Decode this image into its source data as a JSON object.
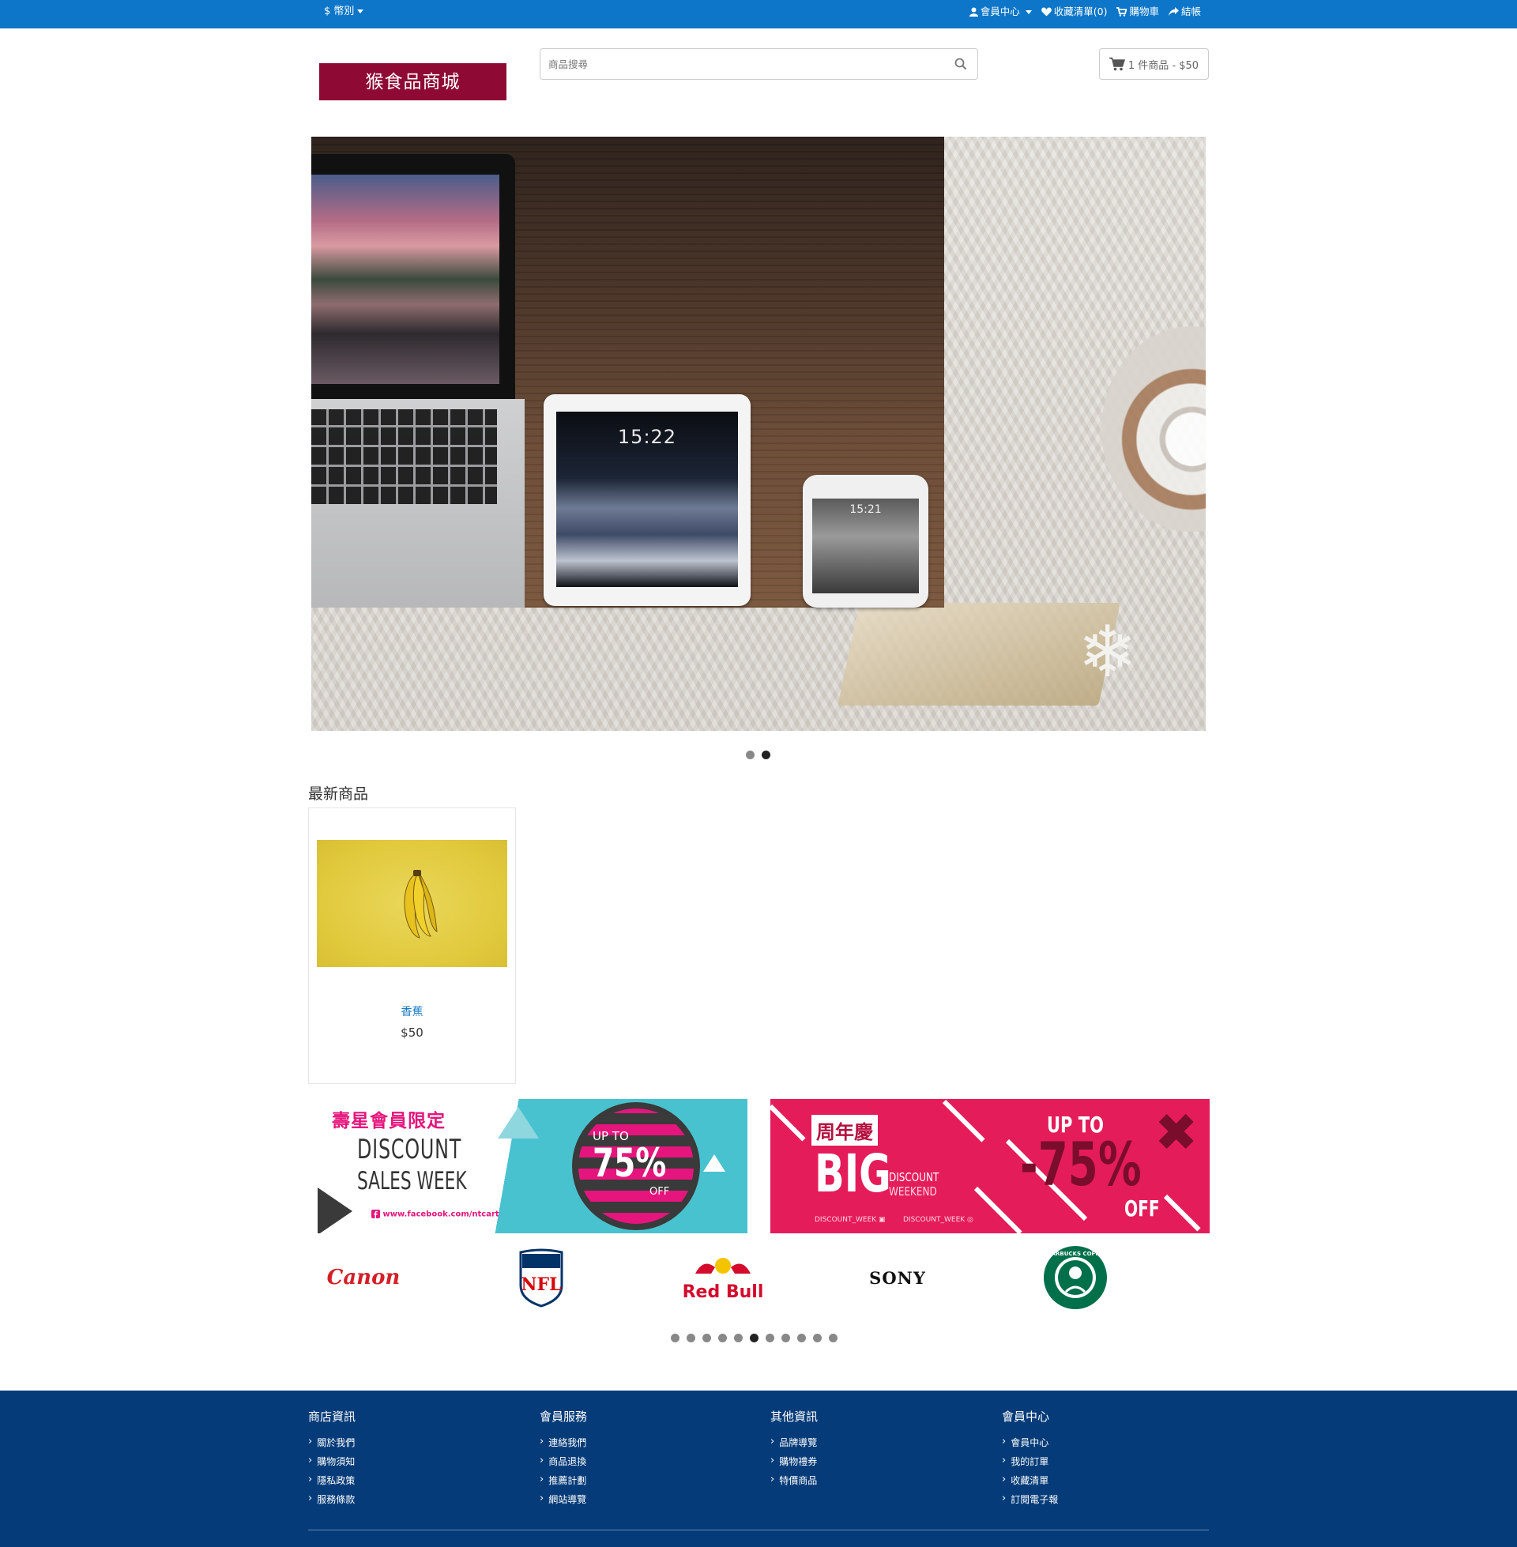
{
  "topbar": {
    "currency": "$ 幣別",
    "links": {
      "member_center": "會員中心",
      "wishlist": "收藏清單(0)",
      "cart": "購物車",
      "checkout": "結帳"
    }
  },
  "header": {
    "logo_text": "猴食品商城",
    "search_placeholder": "商品搜尋",
    "cart_summary": "1 件商品 - $50"
  },
  "hero": {
    "tablet_time": "15:22",
    "phone_time": "15:21",
    "slide_count": 2,
    "active_slide": 2
  },
  "latest": {
    "title": "最新商品",
    "products": [
      {
        "name": "香蕉",
        "price": "$50"
      }
    ]
  },
  "promos": {
    "left": {
      "tag": "壽星會員限定",
      "line1": "DISCOUNT",
      "line2": "SALES WEEK",
      "url": "www.facebook.com/ntcart",
      "upto": "UP TO",
      "percent": "75%",
      "off": "OFF"
    },
    "right": {
      "tag": "周年慶",
      "big": "BIG",
      "discount": "DISCOUNT",
      "weekend": "WEEKEND",
      "handle1": "DISCOUNT_WEEK",
      "handle2": "DISCOUNT_WEEK",
      "upto": "UP TO",
      "percent": "-75%",
      "off": "OFF"
    }
  },
  "brands": {
    "canon": "Canon",
    "nfl": "NFL",
    "redbull": "Red Bull",
    "sony": "SONY",
    "starbucks": "STARBUCKS COFFEE",
    "dot_count": 11,
    "active_dot": 6
  },
  "footer": {
    "columns": [
      {
        "title": "商店資訊",
        "items": [
          "關於我們",
          "購物須知",
          "隱私政策",
          "服務條款"
        ]
      },
      {
        "title": "會員服務",
        "items": [
          "連絡我們",
          "商品退換",
          "推薦計劃",
          "網站導覽"
        ]
      },
      {
        "title": "其他資訊",
        "items": [
          "品牌導覽",
          "購物禮券",
          "特價商品"
        ]
      },
      {
        "title": "會員中心",
        "items": [
          "會員中心",
          "我的訂單",
          "收藏清單",
          "訂閱電子報"
        ]
      }
    ]
  },
  "colors": {
    "topbar": "#0d76c8",
    "logo_bg": "#8e0a34",
    "link": "#1a7bc4",
    "footer_bg": "#053b78"
  }
}
